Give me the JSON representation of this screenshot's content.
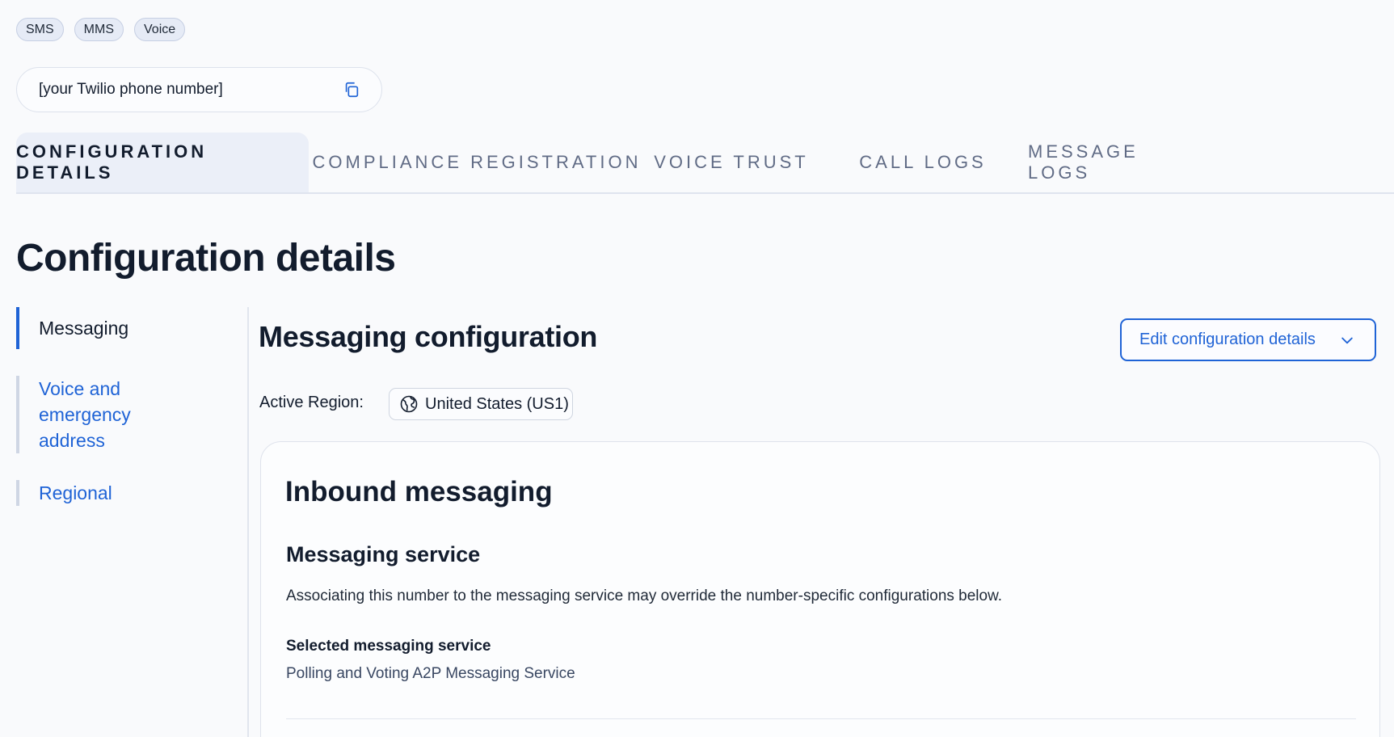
{
  "badges": [
    "SMS",
    "MMS",
    "Voice"
  ],
  "phone": {
    "value": "[your Twilio phone number]"
  },
  "tabs": [
    {
      "label": "CONFIGURATION DETAILS",
      "active": true
    },
    {
      "label": "COMPLIANCE REGISTRATION",
      "active": false
    },
    {
      "label": "VOICE TRUST",
      "active": false
    },
    {
      "label": "CALL LOGS",
      "active": false
    },
    {
      "label": "MESSAGE LOGS",
      "active": false
    }
  ],
  "page_title": "Configuration details",
  "sidenav": [
    {
      "label": "Messaging",
      "active": true
    },
    {
      "label": "Voice and emergency address",
      "active": false
    },
    {
      "label": "Regional",
      "active": false
    }
  ],
  "main": {
    "section_title": "Messaging configuration",
    "edit_button": "Edit configuration details",
    "region_label": "Active Region:",
    "region_value": "United States (US1)"
  },
  "card": {
    "title": "Inbound messaging",
    "subtitle": "Messaging service",
    "description": "Associating this number to the messaging service may override the number-specific configurations below.",
    "field_label": "Selected messaging service",
    "field_value": "Polling and Voting A2P Messaging Service"
  },
  "colors": {
    "accent": "#1f63d6",
    "text": "#121c2d",
    "muted": "#606b85",
    "tab_active_bg": "#ebeff8",
    "badge_bg": "#e6ebf6"
  },
  "icons": {
    "copy": "copy-icon",
    "chevron": "chevron-down-icon",
    "globe": "globe-icon"
  }
}
